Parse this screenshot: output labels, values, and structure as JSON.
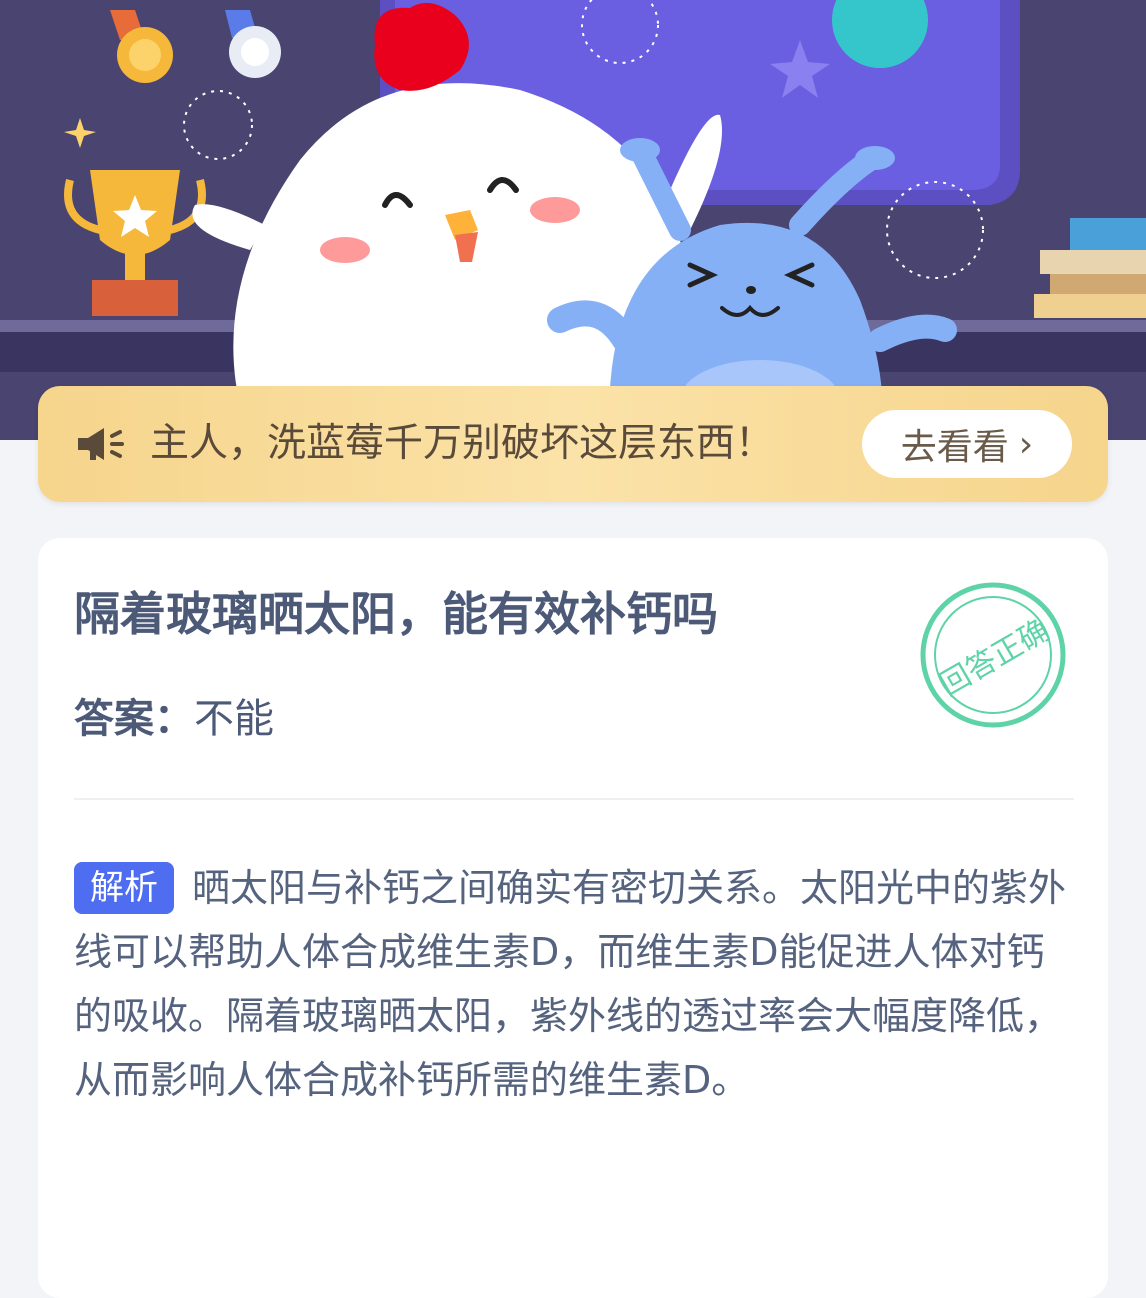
{
  "banner": {
    "text": "主人，洗蓝莓千万别破坏这层东西！",
    "button_label": "去看看",
    "button_arrow": "›"
  },
  "question": {
    "title": "隔着玻璃晒太阳，能有效补钙吗",
    "answer_label": "答案：",
    "answer_value": "不能"
  },
  "stamp": {
    "text": "回答正确"
  },
  "analysis": {
    "tag": "解析",
    "text": "晒太阳与补钙之间确实有密切关系。太阳光中的紫外线可以帮助人体合成维生素D，而维生素D能促进人体对钙的吸收。隔着玻璃晒太阳，紫外线的透过率会大幅度降低，从而影响人体合成补钙所需的维生素D。"
  },
  "colors": {
    "hero_bg": "#4a4470",
    "banner_bg": "#f8dc9c",
    "title": "#4c5a78",
    "tag_bg": "#4e6df0",
    "stamp": "#5fd3a8"
  }
}
